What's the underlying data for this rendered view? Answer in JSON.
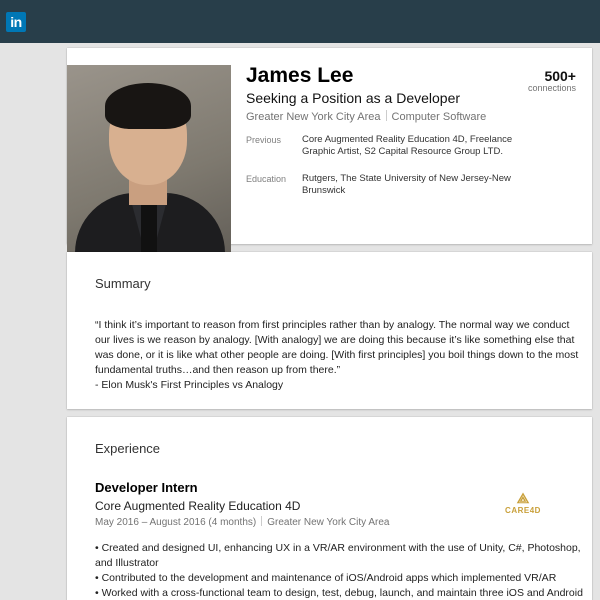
{
  "topbar": {
    "logo_text": "in",
    "logo_icon": "linkedin-logo"
  },
  "profile": {
    "name": "James Lee",
    "headline": "Seeking a Position as a Developer",
    "location": "Greater New York City Area",
    "industry": "Computer Software",
    "connections_count": "500+",
    "connections_label": "connections",
    "previous_label": "Previous",
    "previous_value": "Core Augmented Reality Education 4D, Freelance Graphic Artist, S2 Capital Resource Group LTD.",
    "education_label": "Education",
    "education_value": "Rutgers, The State University of New Jersey-New Brunswick"
  },
  "summary": {
    "title": "Summary",
    "text": "“I think it’s important to reason from first principles rather than by analogy. The normal way we conduct our lives is we reason by analogy. [With analogy] we are doing this because it’s like something else that was done, or it is like what other people are doing. [With first principles] you boil things down to the most fundamental truths…and then reason up from there.”",
    "attribution": "- Elon Musk's First Principles vs Analogy"
  },
  "experience": {
    "title": "Experience",
    "position_title": "Developer Intern",
    "company": "Core Augmented Reality Education 4D",
    "dates": "May 2016 – August 2016 (4 months)",
    "location": "Greater New York City Area",
    "logo_text": "CARE4D",
    "bullets": [
      "• Created and designed UI, enhancing UX in a VR/AR environment with the use of Unity, C#, Photoshop, and Illustrator",
      "• Contributed to the development and maintenance of iOS/Android apps which implemented VR/AR",
      "• Worked with a cross-functional team to design, test, debug, launch, and maintain three iOS and Android applications"
    ]
  },
  "colors": {
    "topbar": "#283e4a",
    "linkedin_blue": "#0077b5",
    "page_bg": "#e4e4e4",
    "logo_gold": "#c9a03a"
  }
}
